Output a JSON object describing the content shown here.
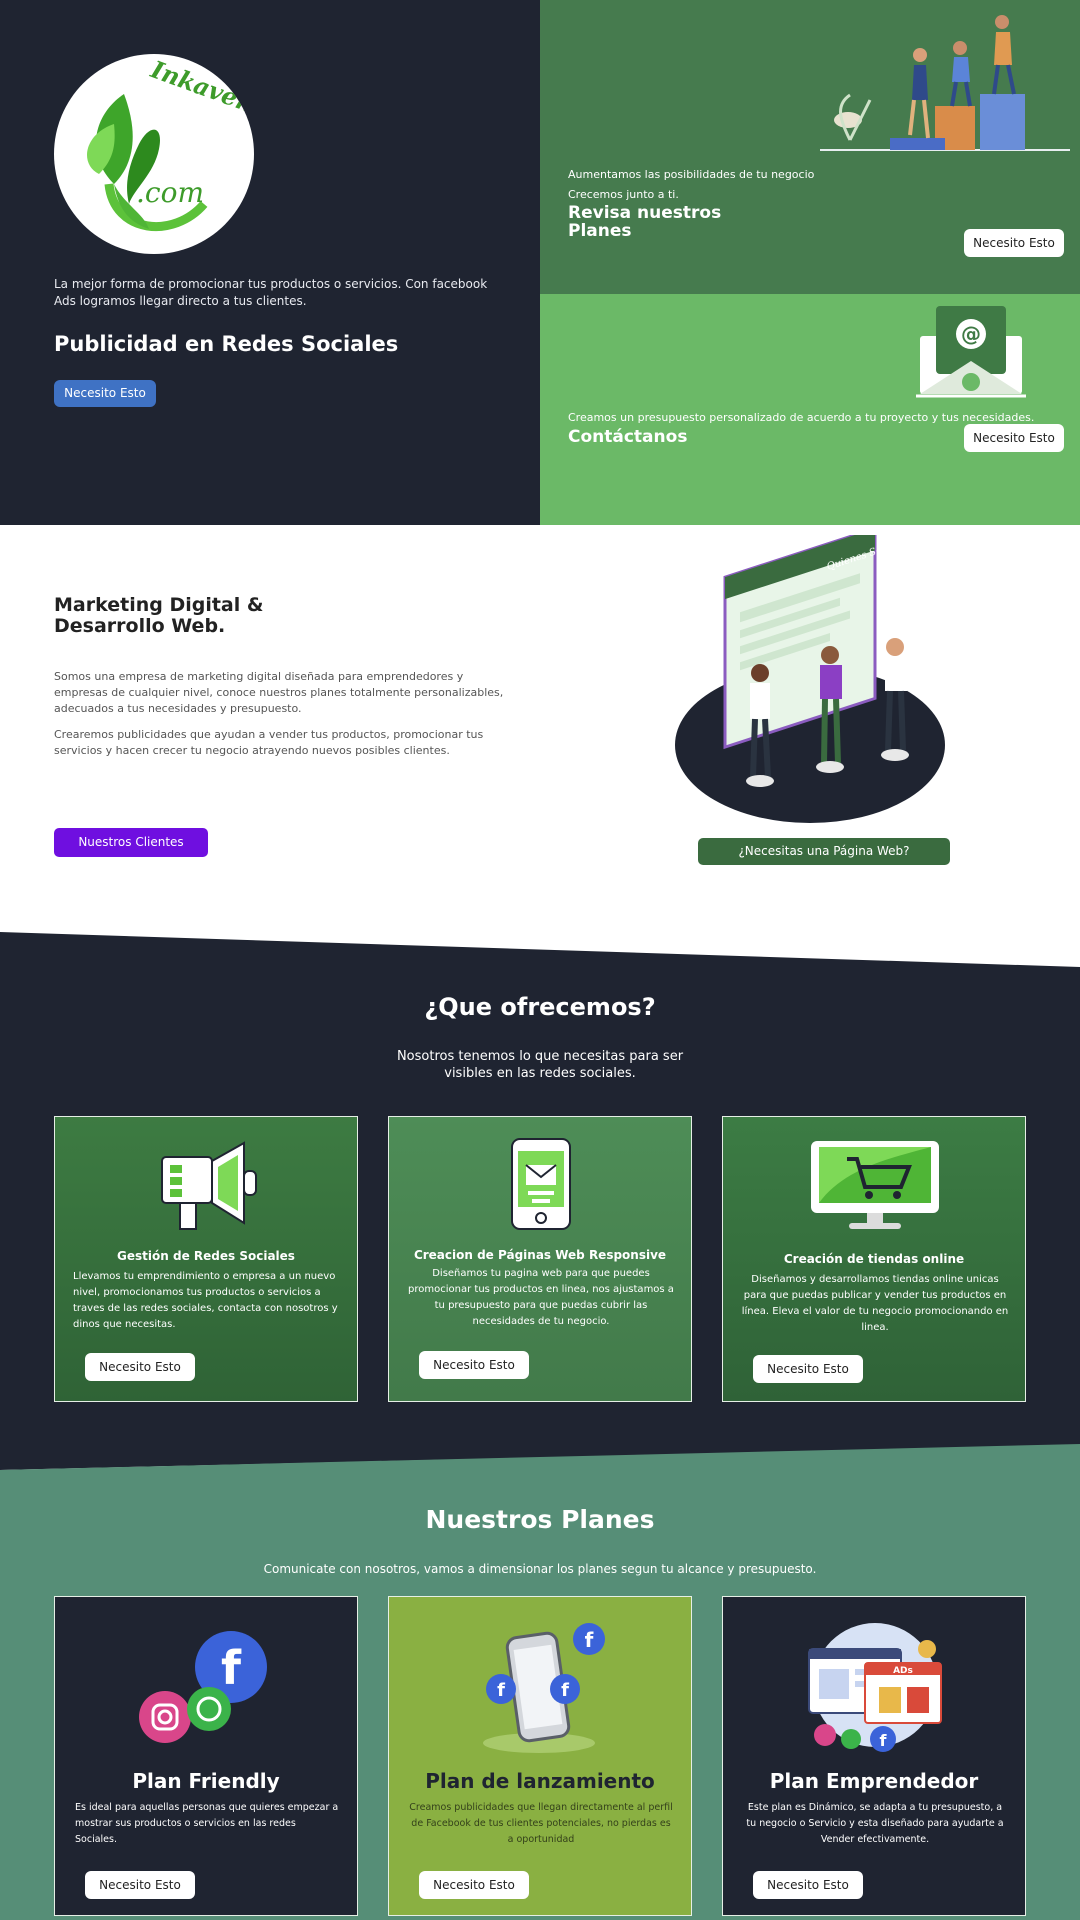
{
  "hero": {
    "logo_text_1": "Inkaven",
    "logo_text_2": ".com",
    "description": "La mejor forma de promocionar tus productos o servicios. Con facebook Ads logramos llegar directo a tus clientes.",
    "headline": "Publicidad en Redes Sociales",
    "button": "Necesito Esto",
    "plans_panel": {
      "line1": "Aumentamos las posibilidades de tu negocio",
      "line2": "Crecemos junto a ti.",
      "title": "Revisa nuestros Planes",
      "button": "Necesito Esto"
    },
    "contact_panel": {
      "line": "Creamos un presupuesto personalizado de acuerdo a tu proyecto y tus necesidades.",
      "title": "Contáctanos",
      "button": "Necesito Esto"
    }
  },
  "about": {
    "title": "Marketing Digital & Desarrollo Web.",
    "paragraph1": "Somos una empresa de marketing digital diseñada para emprendedores y empresas de cualquier nivel, conoce nuestros planes totalmente personalizables, adecuados a tus necesidades y presupuesto.",
    "paragraph2": "Crearemos publicidades que ayudan a vender tus productos, promocionar tus servicios y hacen crecer tu negocio atrayendo nuevos posibles clientes.",
    "clients_button": "Nuestros Clientes",
    "web_button": "¿Necesitas una Página Web?",
    "illustration_text": "Quienes Somos"
  },
  "offer": {
    "title": "¿Que ofrecemos?",
    "subtitle": "Nosotros tenemos lo que necesitas para ser visibles en las redes sociales.",
    "cards": [
      {
        "icon": "megaphone-icon",
        "title": "Gestión de Redes Sociales",
        "text": "Llevamos tu emprendimiento o empresa a un nuevo nivel, promocionamos tus productos o servicios a traves de las redes sociales, contacta con nosotros y dinos que necesitas.",
        "button": "Necesito Esto"
      },
      {
        "icon": "mobile-mail-icon",
        "title": "Creacion de Páginas Web Responsive",
        "text": "Diseñamos tu pagina web para que puedes promocionar tus productos en linea, nos ajustamos a tu presupuesto para que puedas cubrir las necesidades de tu negocio.",
        "button": "Necesito Esto"
      },
      {
        "icon": "shopping-cart-monitor-icon",
        "title": "Creación de tiendas online",
        "text": "Diseñamos y desarrollamos tiendas online unicas para que puedas publicar y vender tus productos en línea. Eleva el valor de tu negocio promocionando en linea.",
        "button": "Necesito Esto"
      }
    ]
  },
  "plans": {
    "title": "Nuestros Planes",
    "subtitle": "Comunicate con nosotros, vamos a dimensionar los planes segun tu alcance y presupuesto.",
    "items": [
      {
        "title": "Plan Friendly",
        "text": "Es ideal para aquellas personas que quieres empezar a mostrar sus productos o servicios en las redes Sociales.",
        "button": "Necesito Esto"
      },
      {
        "title": "Plan de lanzamiento",
        "text": "Creamos publicidades que llegan directamente al perfil de Facebook de tus clientes potenciales, no pierdas es a oportunidad",
        "button": "Necesito Esto"
      },
      {
        "title": "Plan Emprendedor",
        "text": "Este plan es Dinámico, se adapta a tu presupuesto, a tu negocio o Servicio y esta diseñado para ayudarte a Vender efectivamente.",
        "button": "Necesito Esto",
        "badge": "ADs"
      }
    ]
  },
  "colors": {
    "dark": "#1f2431",
    "green_dark": "#467b4e",
    "green_light": "#6bb967",
    "teal": "#568e77",
    "blue_button": "#3f72c4",
    "purple_button": "#6f0fe0",
    "olive": "#8ab042"
  }
}
